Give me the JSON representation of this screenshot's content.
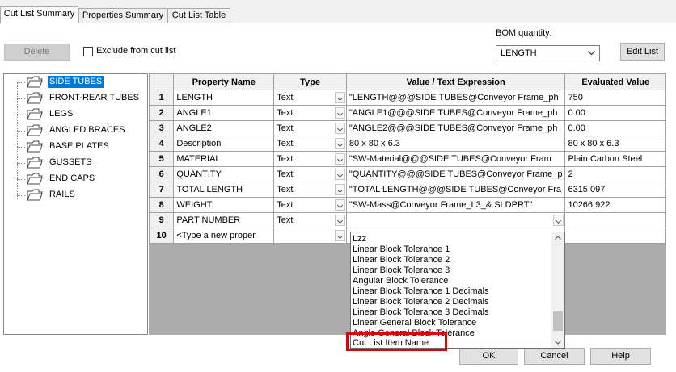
{
  "tabs": [
    {
      "label": "Cut List Summary",
      "active": true
    },
    {
      "label": "Properties Summary",
      "active": false
    },
    {
      "label": "Cut List Table",
      "active": false
    }
  ],
  "toolbar": {
    "delete_label": "Delete",
    "exclude_label": "Exclude from cut list",
    "bom_quantity_label": "BOM quantity:",
    "bom_quantity_value": "LENGTH",
    "edit_list_label": "Edit List"
  },
  "tree": {
    "items": [
      "SIDE TUBES",
      "FRONT-REAR TUBES",
      "LEGS",
      "ANGLED BRACES",
      "BASE PLATES",
      "GUSSETS",
      "END CAPS",
      "RAILS"
    ],
    "selected_index": 0
  },
  "grid": {
    "headers": [
      "Property Name",
      "Type",
      "Value / Text Expression",
      "Evaluated Value"
    ],
    "rows": [
      {
        "num": "1",
        "name": "LENGTH",
        "type": "Text",
        "expr": "\"LENGTH@@@SIDE TUBES@Conveyor Frame_ph",
        "value": "750"
      },
      {
        "num": "2",
        "name": "ANGLE1",
        "type": "Text",
        "expr": "\"ANGLE1@@@SIDE TUBES@Conveyor Frame_ph",
        "value": "0.00"
      },
      {
        "num": "3",
        "name": "ANGLE2",
        "type": "Text",
        "expr": "\"ANGLE2@@@SIDE TUBES@Conveyor Frame_ph",
        "value": "0.00"
      },
      {
        "num": "4",
        "name": "Description",
        "type": "Text",
        "expr": "80 x 80 x 6.3",
        "value": "80 x 80 x 6.3"
      },
      {
        "num": "5",
        "name": "MATERIAL",
        "type": "Text",
        "expr": "\"SW-Material@@@SIDE TUBES@Conveyor Fram",
        "value": "Plain Carbon Steel"
      },
      {
        "num": "6",
        "name": "QUANTITY",
        "type": "Text",
        "expr": "\"QUANTITY@@@SIDE TUBES@Conveyor Frame_p",
        "value": "2"
      },
      {
        "num": "7",
        "name": "TOTAL LENGTH",
        "type": "Text",
        "expr": "\"TOTAL LENGTH@@@SIDE TUBES@Conveyor Fra",
        "value": "6315.097"
      },
      {
        "num": "8",
        "name": "WEIGHT",
        "type": "Text",
        "expr": "\"SW-Mass@Conveyor Frame_L3_&.SLDPRT\"",
        "value": "10266.922"
      },
      {
        "num": "9",
        "name": "PART NUMBER",
        "type": "Text",
        "expr": "",
        "value": ""
      },
      {
        "num": "10",
        "name": "<Type a new proper",
        "type": "",
        "expr": "",
        "value": ""
      }
    ]
  },
  "dropdown": {
    "items": [
      "Lzz",
      "Linear Block Tolerance 1",
      "Linear Block Tolerance 2",
      "Linear Block Tolerance 3",
      "Angular Block Tolerance",
      "Linear Block Tolerance 1 Decimals",
      "Linear Block Tolerance 2 Decimals",
      "Linear Block Tolerance 3 Decimals",
      "Linear General Block Tolerance",
      "Angle General Block Tolerance",
      "Cut List Item Name"
    ],
    "highlighted": "Cut List Item Name",
    "highlight_color": "#e00000"
  },
  "footer": {
    "ok_label": "OK",
    "cancel_label": "Cancel",
    "help_label": "Help"
  },
  "colors": {
    "selection": "#0078d7",
    "highlight_box": "#e00000"
  }
}
